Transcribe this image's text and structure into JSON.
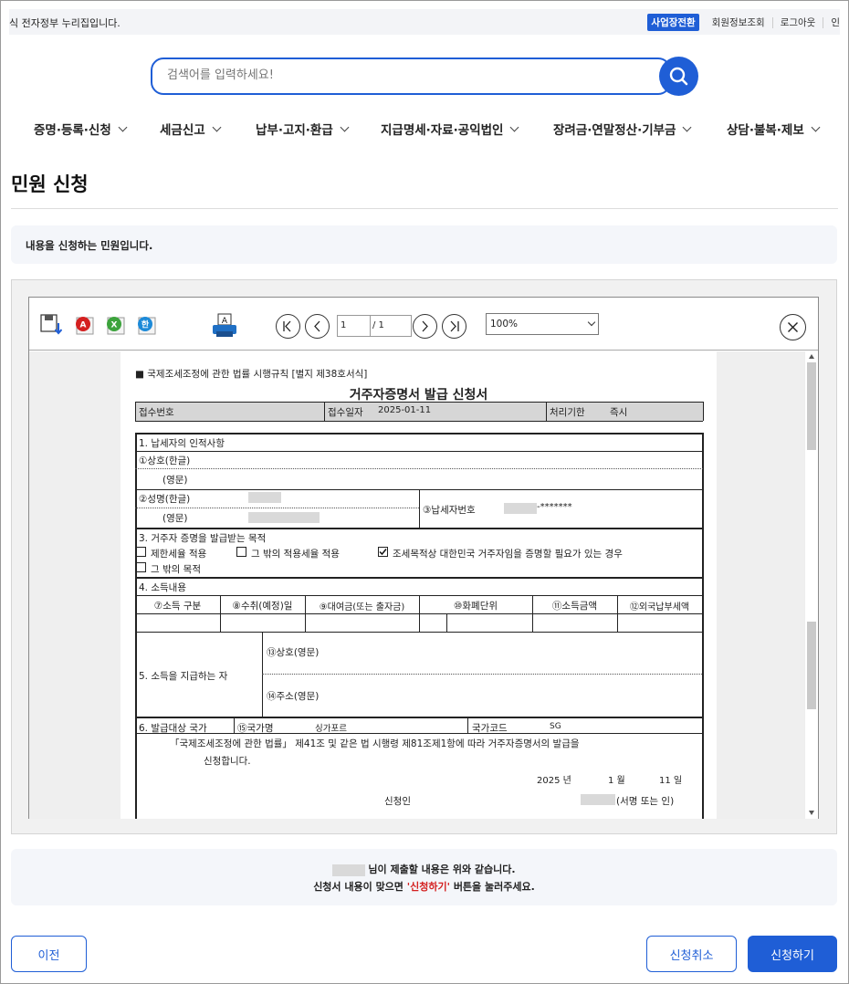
{
  "topbar": {
    "notice": "식 전자정부 누리집입니다.",
    "business_switch": "사업장전환",
    "member_info": "회원정보조회",
    "logout": "로그아웃",
    "more": "인"
  },
  "search": {
    "placeholder": "검색어를 입력하세요!"
  },
  "nav": {
    "items": [
      {
        "label": "증명·등록·신청"
      },
      {
        "label": "세금신고"
      },
      {
        "label": "납부·고지·환급"
      },
      {
        "label": "지급명세·자료·공익법인"
      },
      {
        "label": "장려금·연말정산·기부금"
      },
      {
        "label": "상담·불복·제보"
      }
    ]
  },
  "page": {
    "title": "민원 신청",
    "info": "내용을 신청하는 민원입니다."
  },
  "viewer": {
    "page_current": "1",
    "page_total": "/ 1",
    "zoom": "100%",
    "icons": [
      "save-icon",
      "pdf-icon",
      "excel-icon",
      "hwp-icon",
      "print-icon"
    ]
  },
  "form": {
    "header": "■ 국제조세조정에 관한 법률 시행규칙 [별지 제38호서식]",
    "title": "거주자증명서 발급 신청서",
    "receipt_no": "접수번호",
    "receipt_date_label": "접수일자",
    "receipt_date": "2025-01-11",
    "process_label": "처리기한",
    "process_value": "즉시",
    "s1": "1. 납세자의 인적사항",
    "f1": "①상호(한글)",
    "f1e": "(영문)",
    "f2": "②성명(한글)",
    "f2e": "(영문)",
    "f3": "③납세자번호",
    "f3_mask": "-*******",
    "s3": "3. 거주자 증명을 발급받는 목적",
    "opt1": "제한세율 적용",
    "opt2": "그 밖의 적용세율 적용",
    "opt3": "조세목적상 대한민국 거주자임을 증명할 필요가 있는 경우",
    "opt4": "그 밖의 목적",
    "s4": "4. 소득내용",
    "c7": "⑦소득 구분",
    "c8": "⑧수취(예정)일",
    "c9": "⑨대여금(또는 출자금)",
    "c10": "⑩화폐단위",
    "c11": "⑪소득금액",
    "c12": "⑫외국납부세액",
    "s5": "5. 소득을 지급하는 자",
    "f13": "⑬상호(영문)",
    "f14": "⑭주소(영문)",
    "s6": "6. 발급대상 국가",
    "f15": "⑮국가명",
    "country": "싱가포르",
    "country_code_label": "국가코드",
    "country_code": "SG",
    "statement1": "「국제조세조정에 관한 법률」 제41조 및 같은 법 시행령 제81조제1항에 따라 거주자증명서의 발급을",
    "statement2": "신청합니다.",
    "year": "2025 년",
    "month": "1 월",
    "day": "11 일",
    "applicant": "신청인",
    "sign": "(서명 또는 인)"
  },
  "summary": {
    "line1": "님이 제출할 내용은 위와 같습니다.",
    "line2_pre": "신청서 내용이 맞으면 ",
    "line2_em": "'신청하기'",
    "line2_post": " 버튼을 눌러주세요."
  },
  "buttons": {
    "prev": "이전",
    "cancel": "신청취소",
    "apply": "신청하기"
  },
  "colors": {
    "primary": "#1f5ed6",
    "highlight": "#d42020"
  }
}
